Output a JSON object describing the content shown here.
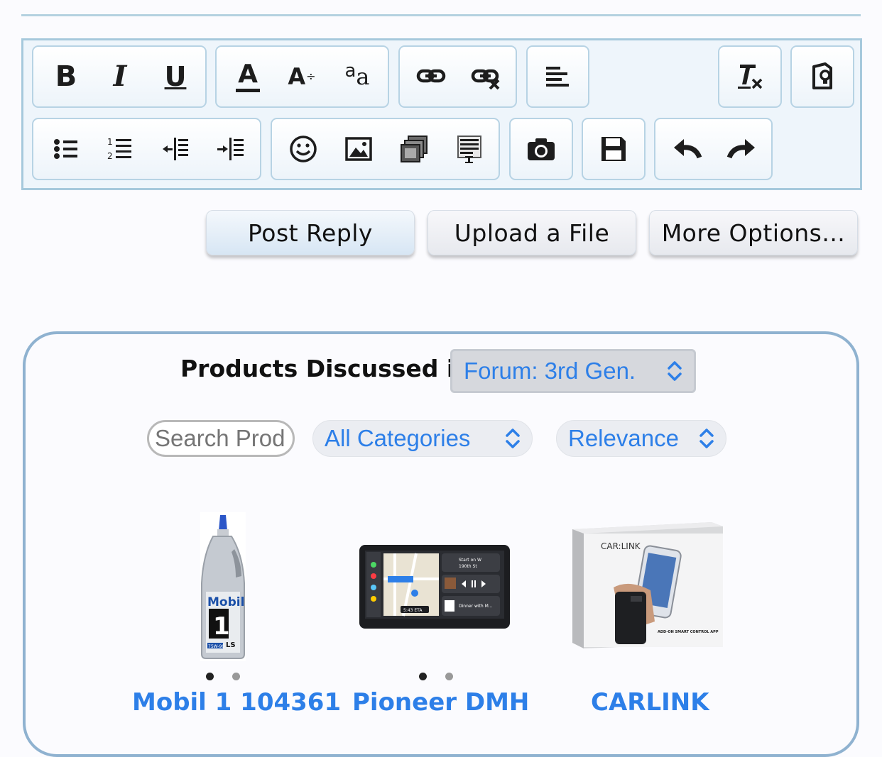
{
  "toolbar": {
    "bold": "B",
    "italic": "I",
    "underline": "U",
    "font_color": "A",
    "font_size": "A",
    "font_family_big": "a",
    "font_family_small": "a"
  },
  "actions": {
    "post_reply": "Post Reply",
    "upload_file": "Upload a File",
    "more_options": "More Options..."
  },
  "products": {
    "heading": "Products Discussed in",
    "forum_select": "Forum: 3rd Gen.",
    "search_placeholder": "Search Prod",
    "category_select": "All Categories",
    "sort_select": "Relevance",
    "items": [
      {
        "title": "Mobil 1 104361",
        "image_text": [
          "Mobil",
          "1",
          "LS",
          "75W-90"
        ]
      },
      {
        "title": "Pioneer DMH",
        "image_text": [
          "Start on W",
          "190th St",
          "Dinner with M...",
          "5:43 ETA"
        ]
      },
      {
        "title": "CARLINK",
        "image_text": [
          "CAR:LINK",
          "ADD-ON SMART CONTROL APP"
        ]
      }
    ]
  },
  "colors": {
    "link": "#2d7fe8",
    "panel_border": "#8fb2d0",
    "toolbar_border": "#a6c9dc"
  }
}
